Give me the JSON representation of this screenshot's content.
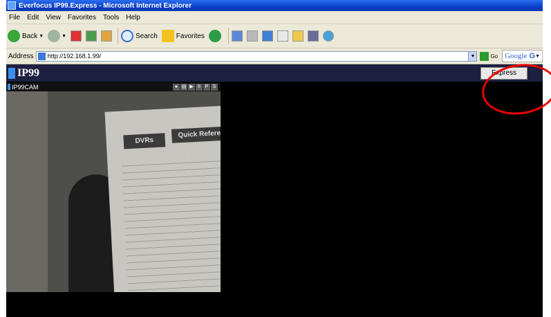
{
  "window": {
    "title": "Everfocus IP99.Express - Microsoft Internet Explorer"
  },
  "menu": [
    "File",
    "Edit",
    "View",
    "Favorites",
    "Tools",
    "Help"
  ],
  "toolbar": {
    "back": "Back",
    "search": "Search",
    "favorites": "Favorites"
  },
  "address": {
    "label": "Address",
    "url": "http://192.168.1.99/",
    "go": "Go"
  },
  "google": {
    "label": "Google"
  },
  "app": {
    "logo": "IP99",
    "express_button": "Express"
  },
  "camera": {
    "name": "IP99CAM",
    "controls": [
      "●",
      "▤",
      "▶",
      "II",
      "P",
      "S"
    ],
    "document": {
      "heading_left": "DVRs",
      "heading_right": "Quick Refere"
    }
  },
  "colors": {
    "app_bar": "#1e2040",
    "highlight_circle": "#e00000",
    "title_bar": "#0a3fc8"
  }
}
